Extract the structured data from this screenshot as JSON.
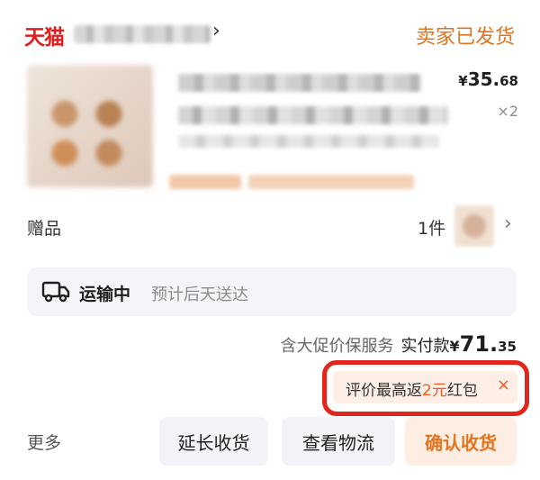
{
  "header": {
    "logo_text": "天猫",
    "order_status": "卖家已发货"
  },
  "item": {
    "price_symbol": "¥",
    "price_int": "35.",
    "price_dec": "68",
    "quantity": "×2"
  },
  "gift": {
    "label": "赠品",
    "count": "1件"
  },
  "shipping": {
    "status": "运输中",
    "eta": "预计后天送达"
  },
  "payment": {
    "protection_text": "含大促价保服务",
    "paid_label": "实付款",
    "price_symbol": "¥",
    "price_int": "71.",
    "price_dec": "35"
  },
  "review_promo": {
    "text_before": "评价最高返",
    "highlight": "2元",
    "text_after": "红包",
    "close_glyph": "×"
  },
  "actions": {
    "more_label": "更多",
    "extend_label": "延长收货",
    "track_label": "查看物流",
    "confirm_label": "确认收货"
  },
  "colors": {
    "accent_orange": "#e3741f",
    "tmall_red": "#e21d1d",
    "promo_highlight": "#f15a22",
    "highlight_frame": "#e0261d"
  }
}
